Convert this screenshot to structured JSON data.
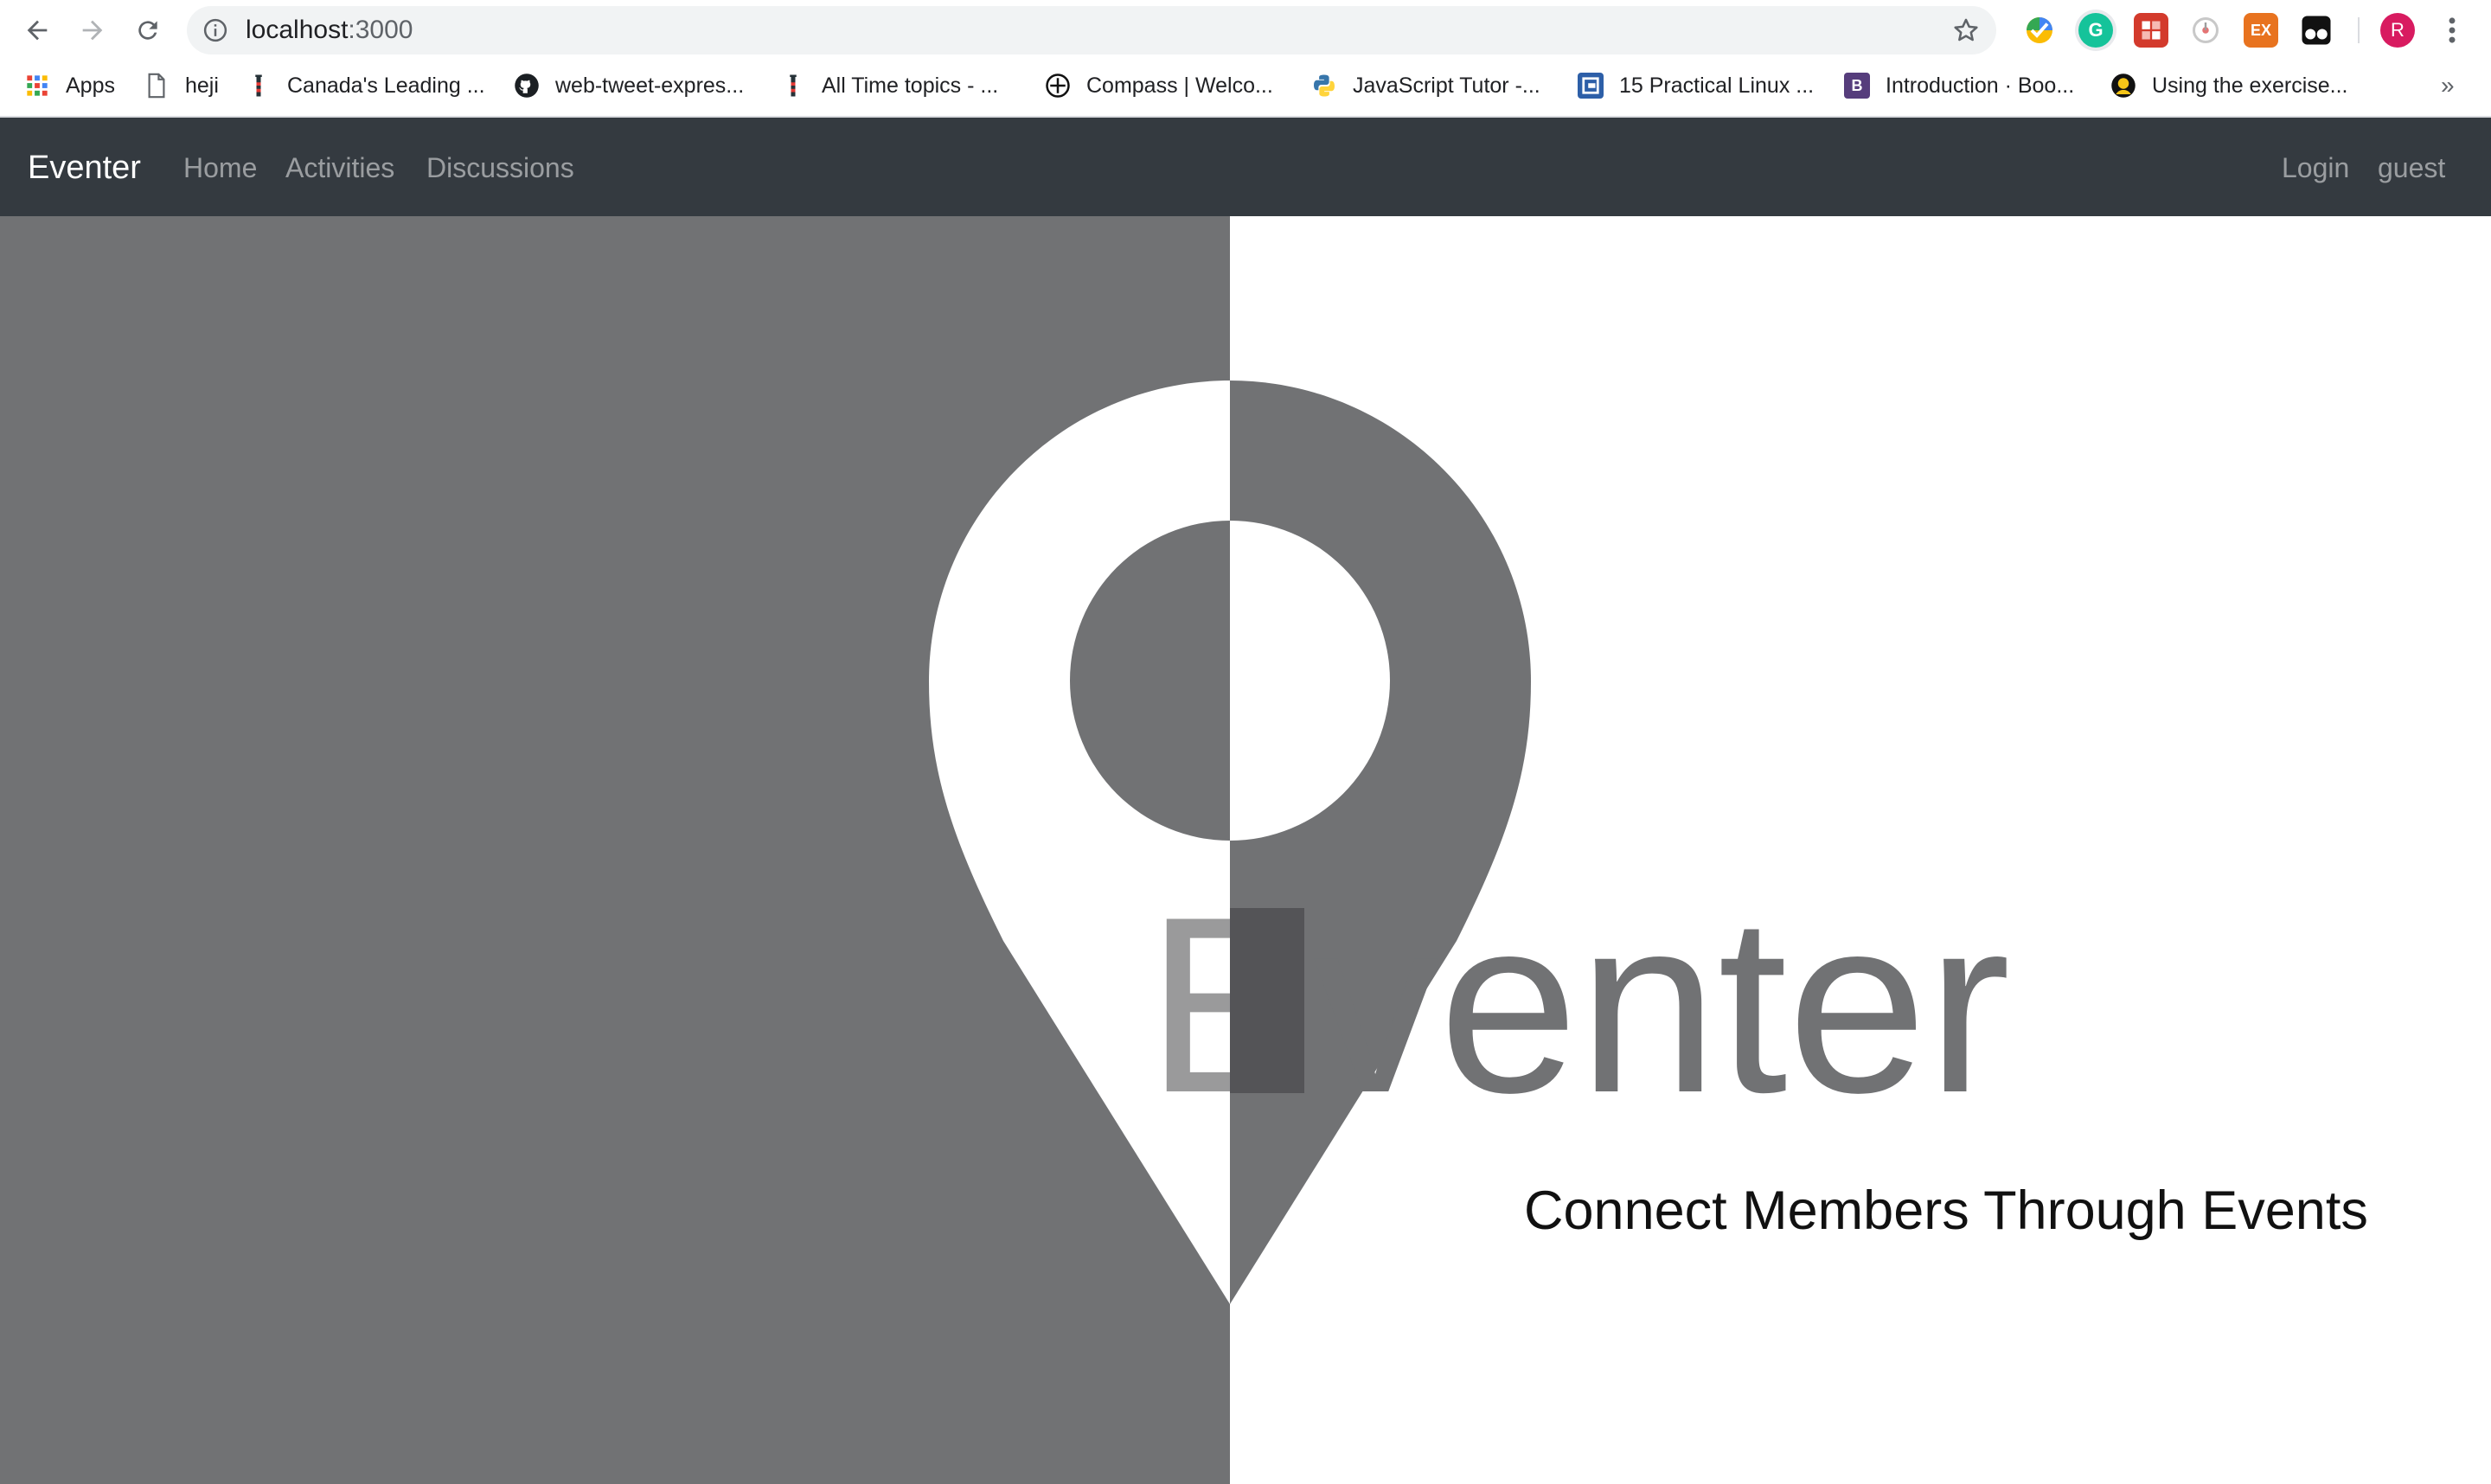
{
  "browser": {
    "url_host": "localhost",
    "url_port": ":3000",
    "profile_initial": "R",
    "extensions": [
      {
        "icon": "colorful-check-extension-icon"
      },
      {
        "icon": "grammarly-extension-icon",
        "glyph": "G"
      },
      {
        "icon": "puzzle-extension-icon"
      },
      {
        "icon": "timer-extension-icon"
      },
      {
        "icon": "ex-extension-icon",
        "glyph": "EX"
      },
      {
        "icon": "tampermonkey-extension-icon"
      }
    ],
    "bookmarks": [
      {
        "label": "Apps",
        "icon": "apps-grid-icon"
      },
      {
        "label": "heji",
        "icon": "page-icon"
      },
      {
        "label": "Canada's Leading ...",
        "icon": "lighthouse-icon"
      },
      {
        "label": "web-tweet-expres...",
        "icon": "github-icon"
      },
      {
        "label": "All Time topics - ...",
        "icon": "lighthouse-icon"
      },
      {
        "label": "Compass | Welco...",
        "icon": "compass-icon"
      },
      {
        "label": "JavaScript Tutor -...",
        "icon": "python-icon"
      },
      {
        "label": "15 Practical Linux ...",
        "icon": "linux-icon"
      },
      {
        "label": "Introduction · Boo...",
        "icon": "bootstrap-icon",
        "glyph": "B"
      },
      {
        "label": "Using the exercise...",
        "icon": "exercise-icon"
      }
    ],
    "more_bookmarks": "»"
  },
  "navbar": {
    "brand": "Eventer",
    "links": [
      "Home",
      "Activities",
      "Discussions"
    ],
    "right_links": [
      "Login",
      "guest"
    ]
  },
  "hero": {
    "logo_text": "Eventer",
    "tagline": "Connect Members Through Events"
  },
  "colors": {
    "navbar_bg": "#343a40",
    "hero_gray": "#717274",
    "hero_white": "#ffffff"
  }
}
